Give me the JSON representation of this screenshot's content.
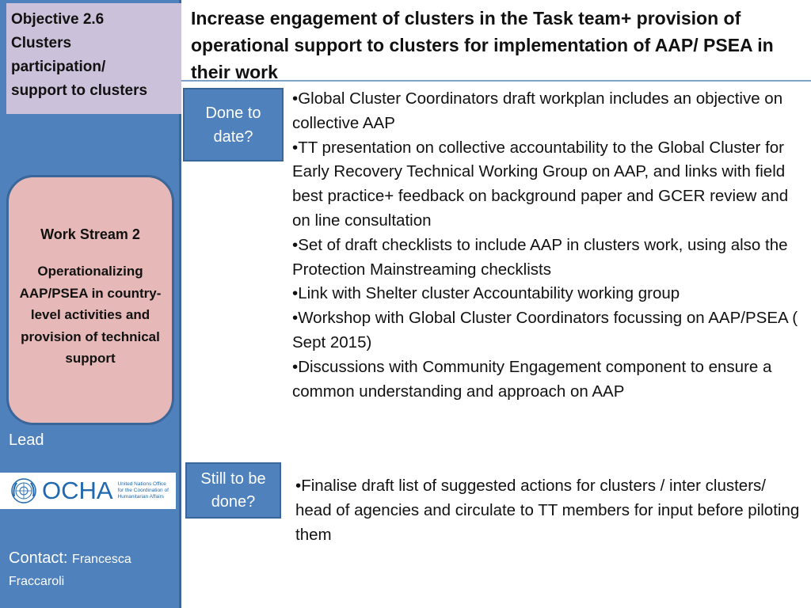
{
  "sidebar": {
    "objective": {
      "lines": [
        "Objective 2.6",
        "Clusters",
        "participation/",
        "support to clusters"
      ]
    },
    "work_stream": {
      "title": "Work Stream 2",
      "description": "Operationalizing AAP/PSEA in country-level activities and provision of technical support"
    },
    "lead_label": "Lead",
    "logo": {
      "icon": "un-emblem-icon",
      "wordmark": "OCHA",
      "subtitle_lines": [
        "United Nations Office",
        "for the Coordination of",
        "Humanitarian  Affairs"
      ]
    },
    "contact": {
      "label": "Contact:",
      "name": "Francesca Fraccaroli"
    }
  },
  "header": {
    "title": "Increase engagement of clusters in the Task team+ provision of operational support to clusters for implementation of AAP/ PSEA in their work"
  },
  "colors": {
    "sidebar_blue": "#4f81bd",
    "objective_lavender": "#ccc1da",
    "stream_pink": "#e6b9b8"
  },
  "done": {
    "label": "Done to date?",
    "items": [
      "Global Cluster Coordinators draft workplan includes an objective on collective AAP",
      "TT presentation on collective accountability to the Global Cluster for  Early Recovery Technical Working Group on AAP, and links with field best practice+ feedback on background paper and GCER review and on line consultation",
      "Set of draft checklists to include AAP in clusters work, using also the Protection Mainstreaming checklists",
      "Link with Shelter cluster Accountability working group",
      "Workshop with Global Cluster Coordinators focussing on AAP/PSEA ( Sept 2015)",
      "Discussions with Community Engagement component to ensure a common understanding and approach on AAP"
    ]
  },
  "still": {
    "label": "Still to be done?",
    "items": [
      "Finalise draft list of suggested actions for clusters / inter clusters/ head of agencies and circulate to TT members for input before piloting them"
    ]
  }
}
